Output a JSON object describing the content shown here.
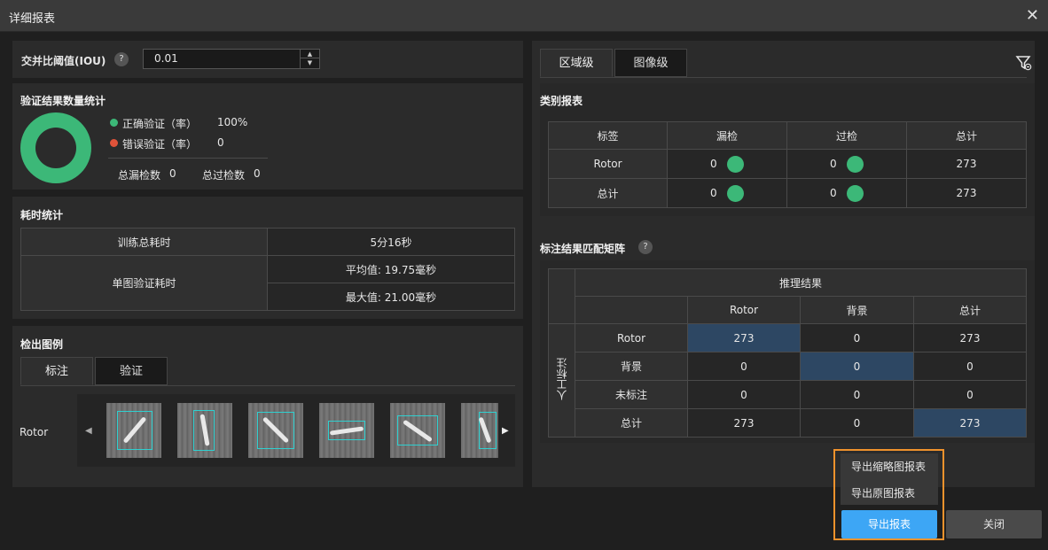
{
  "window": {
    "title": "详细报表",
    "close_glyph": "✕"
  },
  "iou": {
    "label": "交并比阈值(IOU)",
    "help": "?",
    "value": "0.01"
  },
  "verify_stats": {
    "title": "验证结果数量统计",
    "correct_label": "正确验证（率）",
    "correct_value": "100%",
    "correct_color": "#3cb878",
    "wrong_label": "错误验证（率）",
    "wrong_value": "0",
    "wrong_color": "#e0533a",
    "missed_label": "总漏检数",
    "missed_value": "0",
    "over_label": "总过检数",
    "over_value": "0"
  },
  "time_stats": {
    "title": "耗时统计",
    "train_label": "训练总耗时",
    "train_value": "5分16秒",
    "single_label": "单图验证耗时",
    "avg_value": "平均值: 19.75毫秒",
    "max_value": "最大值: 21.00毫秒"
  },
  "examples": {
    "title": "检出图例",
    "tabs": [
      "标注",
      "验证"
    ],
    "row_label": "Rotor"
  },
  "right_tabs": [
    "区域级",
    "图像级"
  ],
  "class_report": {
    "title": "类别报表",
    "headers": [
      "标签",
      "漏检",
      "过检",
      "总计"
    ],
    "rows": [
      {
        "label": "Rotor",
        "missed": "0",
        "over": "0",
        "total": "273"
      },
      {
        "label": "总计",
        "missed": "0",
        "over": "0",
        "total": "273"
      }
    ]
  },
  "matrix": {
    "title": "标注结果匹配矩阵",
    "help": "?",
    "top_header": "推理结果",
    "side_header": "人工标注",
    "col_headers": [
      "Rotor",
      "背景",
      "总计"
    ],
    "rows": [
      {
        "label": "Rotor",
        "values": [
          "273",
          "0",
          "273"
        ]
      },
      {
        "label": "背景",
        "values": [
          "0",
          "0",
          "0"
        ]
      },
      {
        "label": "未标注",
        "values": [
          "0",
          "0",
          "0"
        ]
      },
      {
        "label": "总计",
        "values": [
          "273",
          "0",
          "273"
        ]
      }
    ]
  },
  "export_menu": {
    "thumbnail": "导出缩略图报表",
    "original": "导出原图报表"
  },
  "buttons": {
    "export": "导出报表",
    "close": "关闭"
  },
  "colors": {
    "accent": "#3da6f5",
    "highlight_border": "#f0922c",
    "cell_highlight": "#2d4763"
  }
}
